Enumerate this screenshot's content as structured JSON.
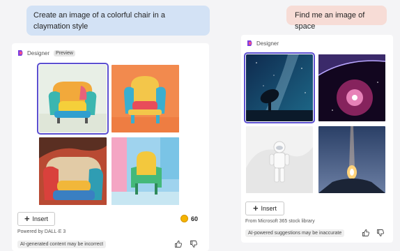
{
  "left_chat": {
    "prompt": "Create an image of a colorful chair in a claymation style",
    "brand_name": "Designer",
    "preview_label": "Preview",
    "images": [
      {
        "subject": "teal and yellow clay armchair",
        "selected": true
      },
      {
        "subject": "orange and blue clay chair on orange background",
        "selected": false
      },
      {
        "subject": "red and teal puffy clay armchair",
        "selected": false
      },
      {
        "subject": "green and yellow clay chair on blue background",
        "selected": false
      }
    ],
    "insert_label": "Insert",
    "boost_count": "60",
    "powered_by": "Powered by DALL·E 3",
    "disclaimer": "AI-generated content may be incorrect"
  },
  "right_chat": {
    "prompt": "Find me an image of space",
    "brand_name": "Designer",
    "images": [
      {
        "subject": "radio telescope under milky way",
        "selected": true
      },
      {
        "subject": "pink nebula and planet",
        "selected": false
      },
      {
        "subject": "astronaut on white background",
        "selected": false
      },
      {
        "subject": "rocket launch at dusk",
        "selected": false
      }
    ],
    "insert_label": "Insert",
    "source_note": "From Microsoft 365 stock library",
    "disclaimer": "AI-powered suggestions may be inaccurate"
  },
  "icons": {
    "thumbs_up": "thumbs-up-icon",
    "thumbs_down": "thumbs-down-icon",
    "plus": "plus-icon",
    "designer_logo": "designer-logo-icon",
    "boost": "boost-coin-icon"
  },
  "colors": {
    "selection_outline": "#5b4fd0",
    "left_bubble": "#d3e2f5",
    "right_bubble": "#f7dcd6",
    "boost_coin": "#f5b400"
  }
}
